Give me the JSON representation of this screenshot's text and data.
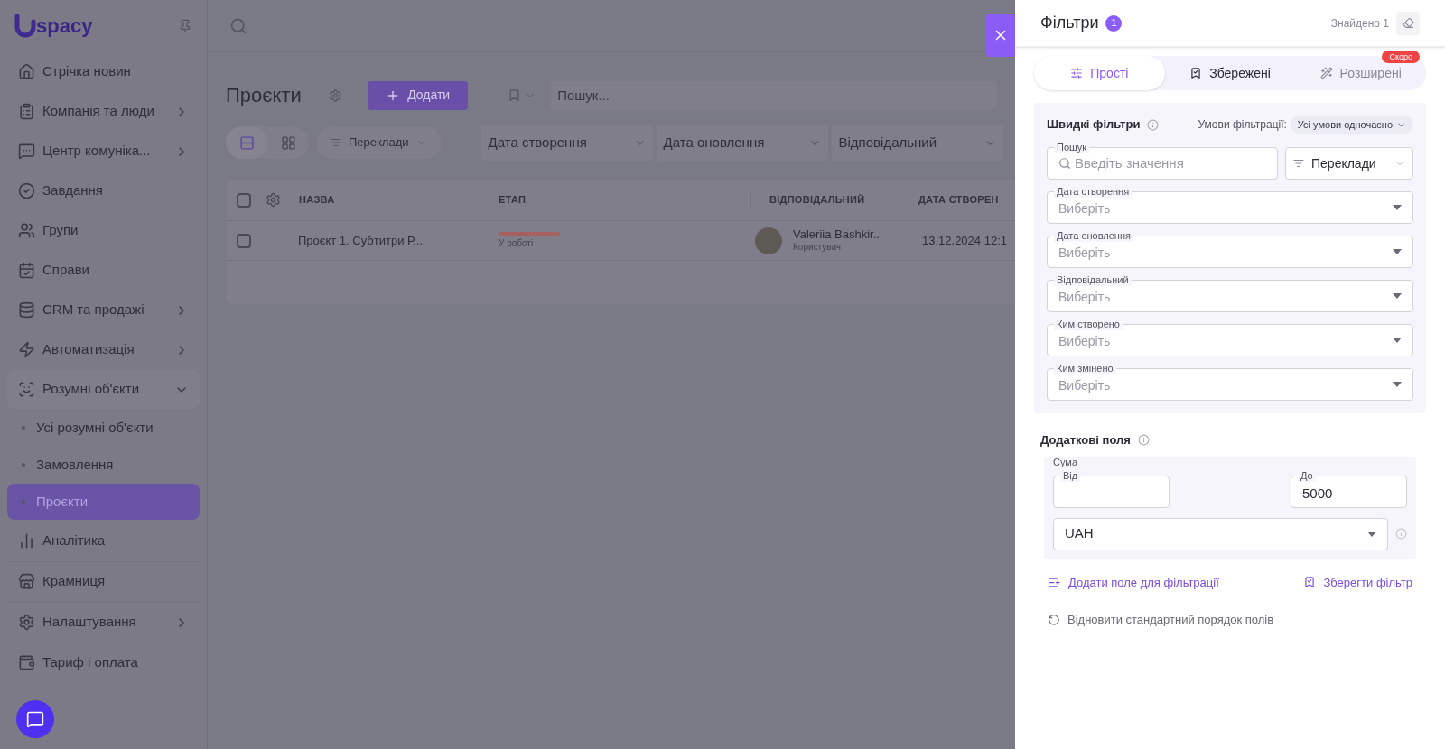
{
  "sidebar": {
    "logo_text": "spacy",
    "items": [
      {
        "label": "Стрічка новин",
        "has_submenu": false
      },
      {
        "label": "Компанія та люди",
        "has_submenu": true
      },
      {
        "label": "Центр комуніка...",
        "has_submenu": true
      },
      {
        "label": "Завдання",
        "has_submenu": false
      },
      {
        "label": "Групи",
        "has_submenu": false
      },
      {
        "label": "Справи",
        "has_submenu": false
      },
      {
        "label": "CRM та продажі",
        "has_submenu": true
      },
      {
        "label": "Автоматизація",
        "has_submenu": true
      },
      {
        "label": "Розумні об'єкти",
        "has_submenu": true,
        "expanded": true,
        "children": [
          {
            "label": "Усі розумні об'єкти",
            "selected": false
          },
          {
            "label": "Замовлення",
            "selected": false
          },
          {
            "label": "Проєкти",
            "selected": true
          }
        ]
      },
      {
        "label": "Аналітика",
        "has_submenu": false
      },
      {
        "label": "Крамниця",
        "has_submenu": false
      },
      {
        "label": "Налаштування",
        "has_submenu": true
      },
      {
        "label": "Тариф і оплата",
        "has_submenu": false
      }
    ]
  },
  "main": {
    "title": "Проєкти",
    "add_button": "Додати",
    "search": {
      "placeholder": "Пошук..."
    },
    "views": [
      {
        "kind": "list",
        "selected": true
      },
      {
        "kind": "grid",
        "selected": false
      }
    ],
    "filter_pill": "Переклади",
    "filters": [
      "Дата створення",
      "Дата оновлення",
      "Відповідальний"
    ],
    "table": {
      "select_all_checked": false,
      "columns": [
        "НАЗВА",
        "ЕТАП",
        "ВІДПОВІДАЛЬНИЙ",
        "ДАТА СТВОРЕН"
      ],
      "rows": [
        {
          "checked": false,
          "name": "Проєкт 1. Субтитри Р...",
          "stage": "У роботі",
          "level": 0.25,
          "person": "Valeriia Bashkir...",
          "role": "Користувач",
          "date": "13.12.2024 12:1"
        }
      ]
    }
  },
  "filter_panel": {
    "title": "Фільтри",
    "count": "1",
    "found": "Знайдено 1",
    "tabs": [
      {
        "label": "Прості",
        "selected": true,
        "disabled": false
      },
      {
        "label": "Збережені",
        "selected": false,
        "disabled": false
      },
      {
        "label": "Розширені",
        "selected": false,
        "disabled": true,
        "badge": "Скоро"
      }
    ],
    "quick": {
      "title": "Швидкі фільтри",
      "conditions_label": "Умови фільтрації:",
      "conditions_value": "Усі умови одночасно",
      "search": {
        "label": "Пошук",
        "placeholder": "Введіть значення"
      },
      "search_select": "Переклади",
      "selects": [
        {
          "label": "Дата створення",
          "placeholder": "Виберіть"
        },
        {
          "label": "Дата оновлення",
          "placeholder": "Виберіть"
        },
        {
          "label": "Відповідальний",
          "placeholder": "Виберіть"
        },
        {
          "label": "Ким створено",
          "placeholder": "Виберіть"
        },
        {
          "label": "Ким змінено",
          "placeholder": "Виберіть"
        }
      ]
    },
    "additional": {
      "title": "Додаткові поля",
      "group_label": "Сума",
      "from": {
        "label": "Від"
      },
      "to": {
        "label": "До",
        "value": "5000"
      },
      "currency": "UAH"
    },
    "add_field": "Додати поле для фільтрації",
    "save_filter": "Зберегти фільтр",
    "restore": "Відновити стандартний порядок полів"
  }
}
